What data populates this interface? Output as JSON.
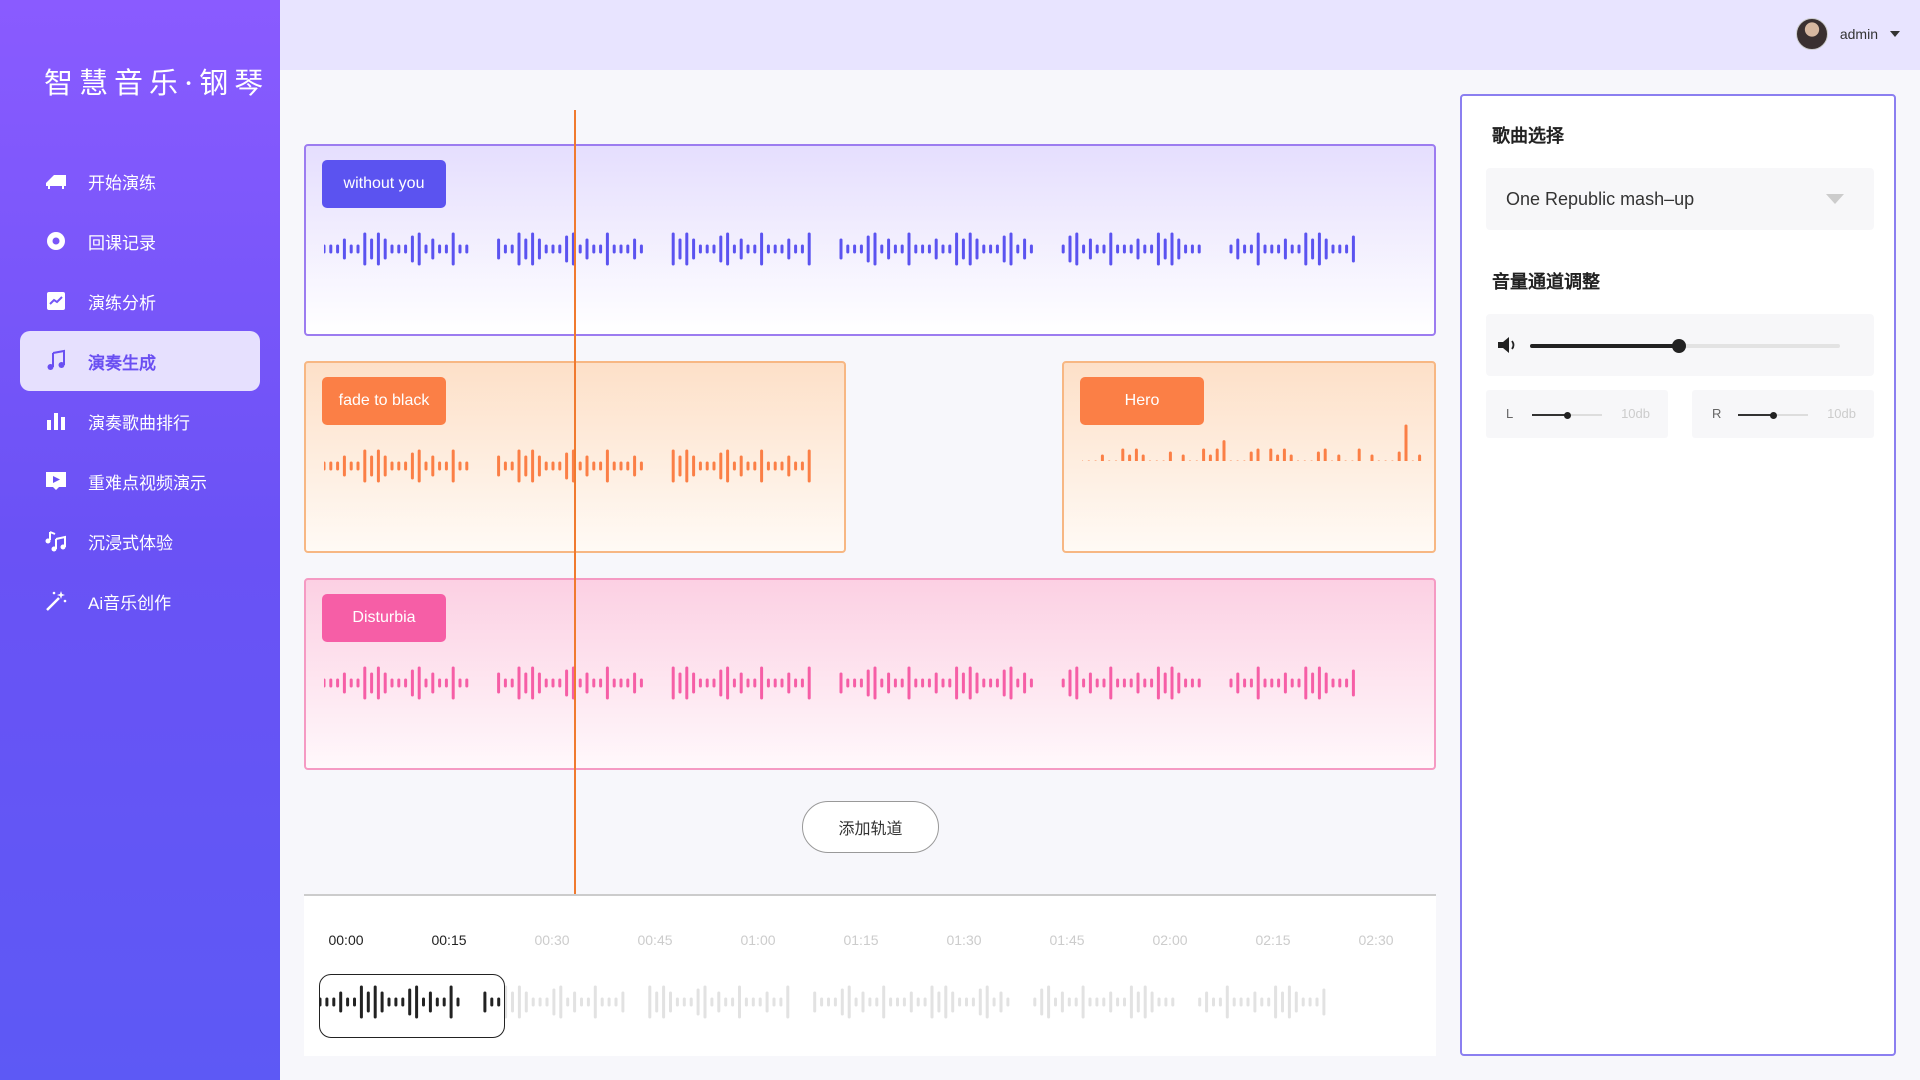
{
  "app": {
    "logo": "智慧音乐·钢琴"
  },
  "sidebar": {
    "items": [
      {
        "label": "开始演练",
        "icon": "piano-icon",
        "active": false
      },
      {
        "label": "回课记录",
        "icon": "record-icon",
        "active": false
      },
      {
        "label": "演练分析",
        "icon": "trend-chart-icon",
        "active": false
      },
      {
        "label": "演奏生成",
        "icon": "music-note-icon",
        "active": true
      },
      {
        "label": "演奏歌曲排行",
        "icon": "bar-chart-icon",
        "active": false
      },
      {
        "label": "重难点视频演示",
        "icon": "video-play-icon",
        "active": false
      },
      {
        "label": "沉浸式体验",
        "icon": "music-notes-icon",
        "active": false
      },
      {
        "label": "Ai音乐创作",
        "icon": "magic-wand-icon",
        "active": false
      }
    ]
  },
  "header": {
    "username": "admin"
  },
  "tracks": [
    {
      "label": "without you",
      "color": "#5b53f0"
    },
    {
      "label": "fade to black",
      "color": "#fb7f46"
    },
    {
      "label": "Hero",
      "color": "#fb7f46"
    },
    {
      "label": "Disturbia",
      "color": "#f65ea6"
    }
  ],
  "add_track_label": "添加轨道",
  "timeline": {
    "ticks": [
      "00:00",
      "00:15",
      "00:30",
      "00:45",
      "01:00",
      "01:15",
      "01:30",
      "01:45",
      "02:00",
      "02:15",
      "02:30"
    ],
    "played_ticks": 2
  },
  "panel": {
    "song_section_title": "歌曲选择",
    "song_selected": "One Republic mash–up",
    "volume_section_title": "音量通道调整",
    "master_volume": 0.48,
    "left_channel": {
      "label": "L",
      "value_label": "10db",
      "level": 0.5
    },
    "right_channel": {
      "label": "R",
      "value_label": "10db",
      "level": 0.5
    }
  }
}
